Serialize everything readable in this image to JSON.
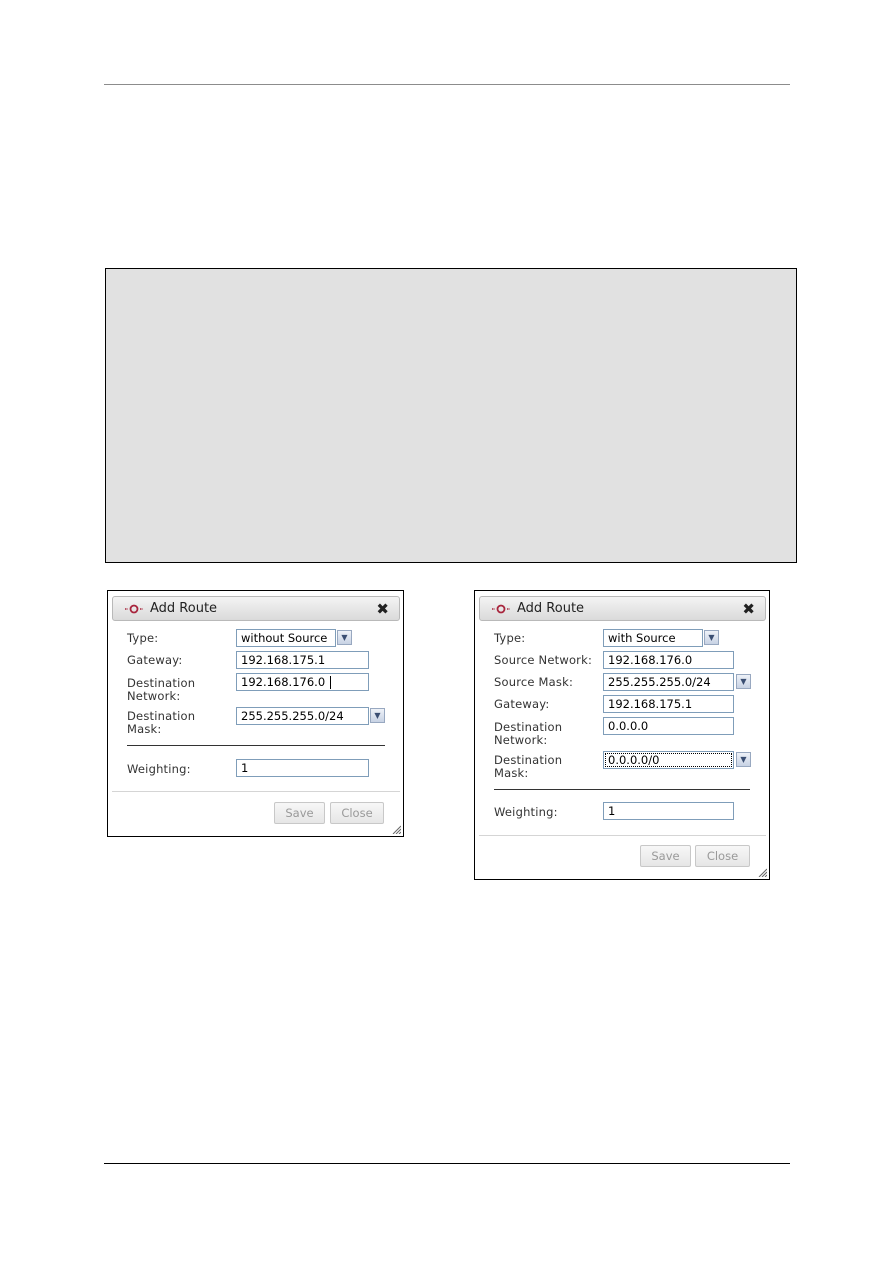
{
  "page": {
    "figure_box": {
      "background": "#e1e1e1"
    }
  },
  "dialogs": [
    {
      "title": "Add Route",
      "fields": {
        "type_label": "Type:",
        "type_value": "without Source",
        "gateway_label": "Gateway:",
        "gateway_value": "192.168.175.1",
        "dest_network_label_1": "Destination",
        "dest_network_label_2": "Network:",
        "dest_network_value": "192.168.176.0",
        "dest_mask_label_1": "Destination",
        "dest_mask_label_2": "Mask:",
        "dest_mask_value": "255.255.255.0/24",
        "weighting_label": "Weighting:",
        "weighting_value": "1"
      },
      "buttons": {
        "save": "Save",
        "close": "Close"
      }
    },
    {
      "title": "Add Route",
      "fields": {
        "type_label": "Type:",
        "type_value": "with Source",
        "source_network_label": "Source Network:",
        "source_network_value": "192.168.176.0",
        "source_mask_label": "Source Mask:",
        "source_mask_value": "255.255.255.0/24",
        "gateway_label": "Gateway:",
        "gateway_value": "192.168.175.1",
        "dest_network_label_1": "Destination",
        "dest_network_label_2": "Network:",
        "dest_network_value": "0.0.0.0",
        "dest_mask_label_1": "Destination",
        "dest_mask_label_2": "Mask:",
        "dest_mask_value": "0.0.0.0/0",
        "weighting_label": "Weighting:",
        "weighting_value": "1"
      },
      "buttons": {
        "save": "Save",
        "close": "Close"
      }
    }
  ],
  "icons": {
    "title_icon": "route-icon",
    "close_icon": "close-icon",
    "dropdown_icon": "chevron-down-icon",
    "resize_icon": "resize-grip-icon"
  },
  "colors": {
    "title_icon": "#a8243c",
    "input_border": "#7f9db9"
  }
}
